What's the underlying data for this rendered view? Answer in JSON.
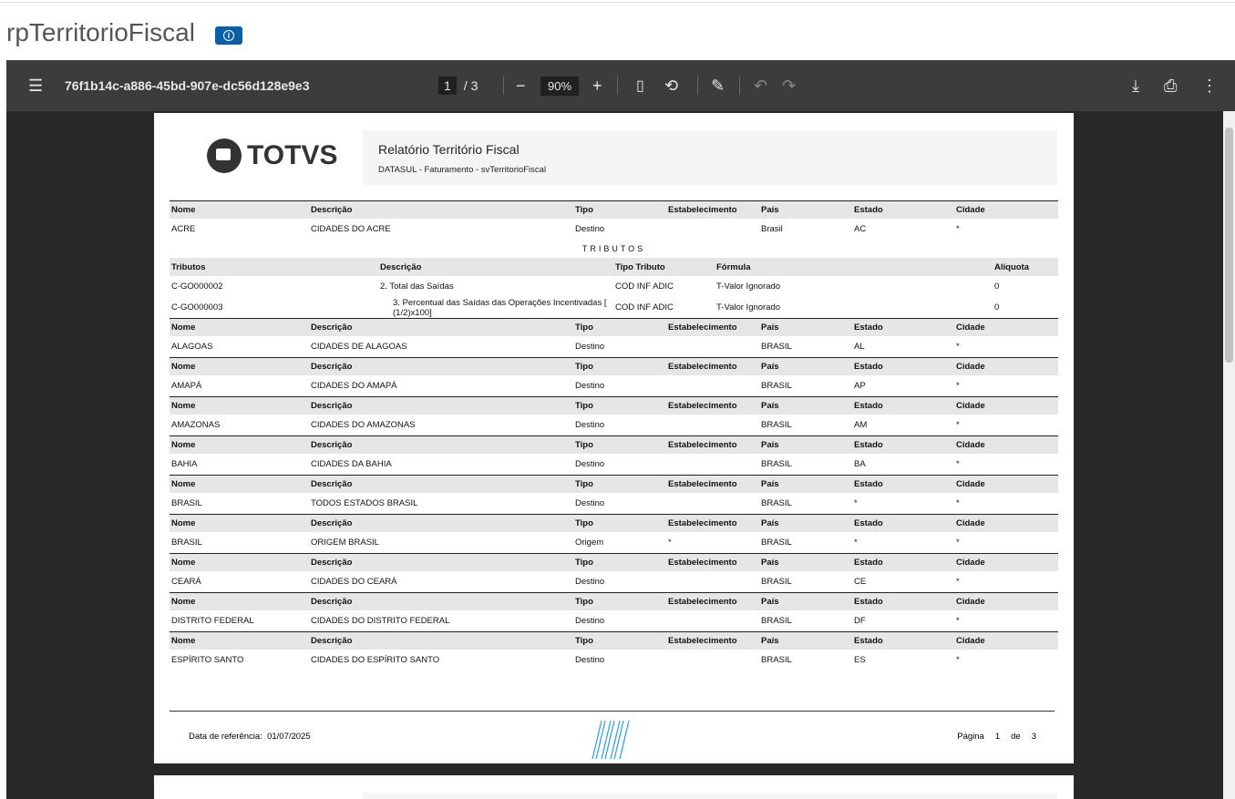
{
  "app": {
    "title": "rpTerritorioFiscal",
    "info_icon": "info-icon"
  },
  "toolbar": {
    "doc_name": "76f1b14c-a886-45bd-907e-dc56d128e9e3",
    "page_current": "1",
    "page_total": "/ 3",
    "zoom": "90%"
  },
  "report": {
    "logo_text": "TOTVS",
    "title": "Relatório Território Fiscal",
    "subtitle": "DATASUL - Faturamento - svTerritorioFiscal",
    "headers": [
      "Nome",
      "Descrição",
      "Tipo",
      "Estabelecimento",
      "País",
      "Estado",
      "Cidade"
    ],
    "tributos_title": "TRIBUTOS",
    "tributos_headers": [
      "Tributos",
      "Descrição",
      "Tipo Tributo",
      "Fórmula",
      "Alíquota"
    ],
    "tributos": [
      [
        "C-GO000002",
        "2. Total das Saídas",
        "COD INF ADIC",
        "T-Valor Ignorado",
        "0"
      ],
      [
        "C-GO000003",
        "3. Percentual das Saídas das Operações Incentivadas [ (1/2)x100]",
        "COD INF ADIC",
        "T-Valor Ignorado",
        "0"
      ]
    ],
    "records": [
      [
        "ACRE",
        "CIDADES DO ACRE",
        "Destino",
        "",
        "Brasil",
        "AC",
        "*"
      ],
      [
        "ALAGOAS",
        "CIDADES DE ALAGOAS",
        "Destino",
        "",
        "BRASIL",
        "AL",
        "*"
      ],
      [
        "AMAPÁ",
        "CIDADES DO AMAPÁ",
        "Destino",
        "",
        "BRASIL",
        "AP",
        "*"
      ],
      [
        "AMAZONAS",
        "CIDADES DO AMAZONAS",
        "Destino",
        "",
        "BRASIL",
        "AM",
        "*"
      ],
      [
        "BAHIA",
        "CIDADES DA BAHIA",
        "Destino",
        "",
        "BRASIL",
        "BA",
        "*"
      ],
      [
        "BRASIL",
        "TODOS ESTADOS BRASIL",
        "Destino",
        "",
        "BRASIL",
        "*",
        "*"
      ],
      [
        "BRASIL",
        "ORIGEM BRASIL",
        "Origem",
        "*",
        "BRASIL",
        "*",
        "*"
      ],
      [
        "CEARÁ",
        "CIDADES DO CEARÁ",
        "Destino",
        "",
        "BRASIL",
        "CE",
        "*"
      ],
      [
        "DISTRITO FEDERAL",
        "CIDADES DO DISTRITO FEDERAL",
        "Destino",
        "",
        "BRASIL",
        "DF",
        "*"
      ],
      [
        "ESPÍRITO SANTO",
        "CIDADES DO ESPÍRITO SANTO",
        "Destino",
        "",
        "BRASIL",
        "ES",
        "*"
      ]
    ],
    "footer": {
      "ref_label": "Data de referência:",
      "ref_date": "01/07/2025",
      "page_label": "Página",
      "page_num": "1",
      "of_label": "de",
      "page_total": "3"
    }
  }
}
